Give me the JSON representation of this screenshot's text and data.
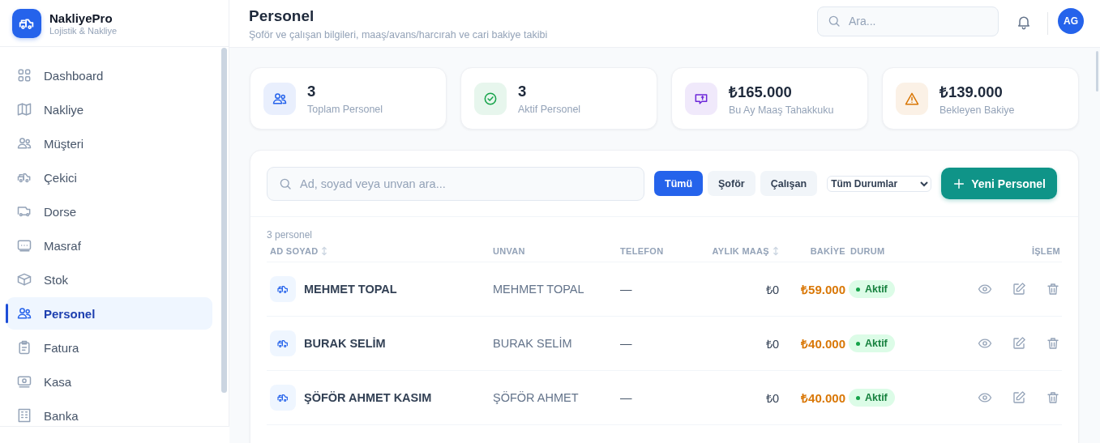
{
  "brand": {
    "name": "NakliyePro",
    "tagline": "Lojistik & Nakliye"
  },
  "sidebar": {
    "items": [
      {
        "label": "Dashboard",
        "selected": false
      },
      {
        "label": "Nakliye",
        "selected": false
      },
      {
        "label": "Müşteri",
        "selected": false
      },
      {
        "label": "Çekici",
        "selected": false
      },
      {
        "label": "Dorse",
        "selected": false
      },
      {
        "label": "Masraf",
        "selected": false
      },
      {
        "label": "Stok",
        "selected": false
      },
      {
        "label": "Personel",
        "selected": true
      },
      {
        "label": "Fatura",
        "selected": false
      },
      {
        "label": "Kasa",
        "selected": false
      },
      {
        "label": "Banka",
        "selected": false
      }
    ]
  },
  "header": {
    "title": "Personel",
    "subtitle": "Şoför ve çalışan bilgileri, maaş/avans/harcırah ve cari bakiye takibi",
    "search": {
      "placeholder": "Ara..."
    },
    "avatar": "AG"
  },
  "stats": [
    {
      "value": "3",
      "label": "Toplam Personel",
      "color": "#2563eb"
    },
    {
      "value": "3",
      "label": "Aktif Personel",
      "color": "#16a34a"
    },
    {
      "value": "₺165.000",
      "label": "Bu Ay Maaş Tahakkuku",
      "color": "#6d28d9"
    },
    {
      "value": "₺139.000",
      "label": "Bekleyen Bakiye",
      "color": "#d97706"
    }
  ],
  "toolbar": {
    "search": {
      "placeholder": "Ad, soyad veya unvan ara..."
    },
    "filters": [
      {
        "label": "Tümü",
        "selected": true
      },
      {
        "label": "Şoför",
        "selected": false
      },
      {
        "label": "Çalışan",
        "selected": false
      }
    ],
    "status_select": "Tüm Durumlar",
    "new_button": "Yeni Personel"
  },
  "table": {
    "count": "3 personel",
    "columns": [
      {
        "label": "AD SOYAD",
        "sortable": true
      },
      {
        "label": "UNVAN",
        "sortable": false
      },
      {
        "label": "TELEFON",
        "sortable": false
      },
      {
        "label": "AYLIK MAAŞ",
        "sortable": true
      },
      {
        "label": "BAKİYE",
        "sortable": false
      },
      {
        "label": "DURUM",
        "sortable": false
      },
      {
        "label": "İŞLEM",
        "sortable": false
      }
    ],
    "rows": [
      {
        "name": "MEHMET TOPAL",
        "title": "MEHMET TOPAL",
        "phone": "—",
        "salary": "₺0",
        "balance": "₺59.000",
        "status": "Aktif"
      },
      {
        "name": "BURAK SELİM",
        "title": "BURAK SELİM",
        "phone": "—",
        "salary": "₺0",
        "balance": "₺40.000",
        "status": "Aktif"
      },
      {
        "name": "ŞÖFÖR AHMET KASIM",
        "title": "ŞÖFÖR AHMET",
        "phone": "—",
        "salary": "₺0",
        "balance": "₺40.000",
        "status": "Aktif"
      }
    ]
  }
}
